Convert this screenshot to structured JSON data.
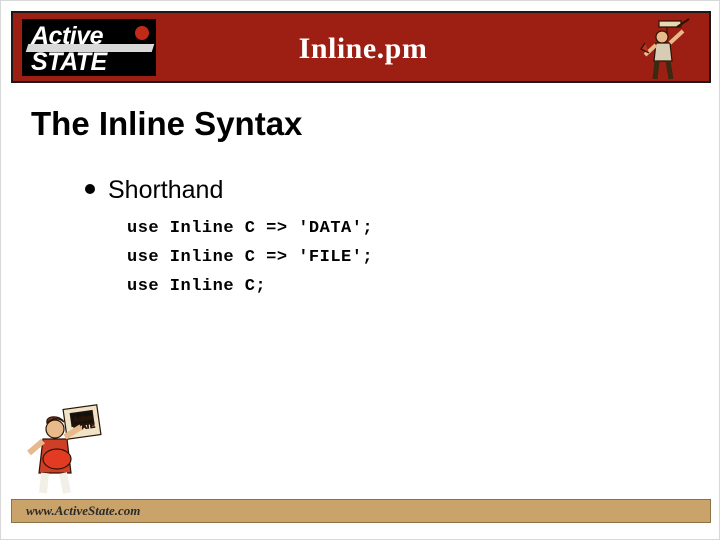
{
  "slide": {
    "header": {
      "title": "Inline.pm",
      "logo": {
        "line1": "Active",
        "line2": "STATE"
      },
      "mascot_icon": "activestate-mascot-icon"
    },
    "heading": "The Inline Syntax",
    "bullets": [
      {
        "label": "Shorthand",
        "code": "use Inline C => 'DATA';\nuse Inline C => 'FILE';\nuse Inline C;"
      }
    ],
    "footer": {
      "url": "www.ActiveState.com",
      "mascot_icon": "activestate-mascot-icon"
    },
    "colors": {
      "header_band": "#9d1f13",
      "footer_band": "#c9a36a",
      "logo_background": "#000000",
      "text": "#000000"
    }
  }
}
